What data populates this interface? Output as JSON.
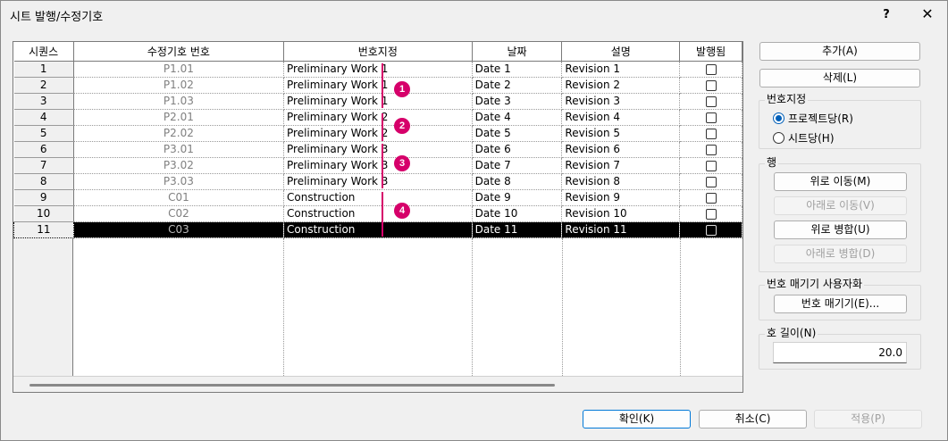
{
  "window": {
    "title": "시트 발행/수정기호",
    "help_label": "?",
    "close_label": "✕"
  },
  "grid": {
    "headers": [
      "시퀀스",
      "수정기호 번호",
      "번호지정",
      "날짜",
      "설명",
      "발행됨"
    ],
    "rows": [
      {
        "seq": "1",
        "number": "P1.01",
        "numbering": "Preliminary Work 1",
        "date": "Date 1",
        "description": "Revision 1",
        "issued": false
      },
      {
        "seq": "2",
        "number": "P1.02",
        "numbering": "Preliminary Work 1",
        "date": "Date 2",
        "description": "Revision 2",
        "issued": false
      },
      {
        "seq": "3",
        "number": "P1.03",
        "numbering": "Preliminary Work 1",
        "date": "Date 3",
        "description": "Revision 3",
        "issued": false
      },
      {
        "seq": "4",
        "number": "P2.01",
        "numbering": "Preliminary Work 2",
        "date": "Date 4",
        "description": "Revision 4",
        "issued": false
      },
      {
        "seq": "5",
        "number": "P2.02",
        "numbering": "Preliminary Work 2",
        "date": "Date 5",
        "description": "Revision 5",
        "issued": false
      },
      {
        "seq": "6",
        "number": "P3.01",
        "numbering": "Preliminary Work 3",
        "date": "Date 6",
        "description": "Revision 6",
        "issued": false
      },
      {
        "seq": "7",
        "number": "P3.02",
        "numbering": "Preliminary Work 3",
        "date": "Date 7",
        "description": "Revision 7",
        "issued": false
      },
      {
        "seq": "8",
        "number": "P3.03",
        "numbering": "Preliminary Work 3",
        "date": "Date 8",
        "description": "Revision 8",
        "issued": false
      },
      {
        "seq": "9",
        "number": "C01",
        "numbering": "Construction",
        "date": "Date 9",
        "description": "Revision 9",
        "issued": false
      },
      {
        "seq": "10",
        "number": "C02",
        "numbering": "Construction",
        "date": "Date 10",
        "description": "Revision 10",
        "issued": false
      },
      {
        "seq": "11",
        "number": "C03",
        "numbering": "Construction",
        "date": "Date 11",
        "description": "Revision 11",
        "issued": false
      }
    ],
    "selected_row": "11"
  },
  "callouts": [
    "1",
    "2",
    "3",
    "4"
  ],
  "callout_color": "#d6006a",
  "buttons": {
    "add": "추가(A)",
    "delete": "삭제(L)"
  },
  "numbering_group": {
    "label": "번호지정",
    "per_project": "프로젝트당(R)",
    "per_sheet": "시트당(H)",
    "selected": "per_project"
  },
  "row_group": {
    "label": "행",
    "move_up": "위로 이동(M)",
    "move_down": "아래로 이동(V)",
    "merge_up": "위로 병합(U)",
    "merge_down": "아래로 병합(D)"
  },
  "customize_group": {
    "label": "번호 매기기 사용자화",
    "numbering_button": "번호 매기기(E)..."
  },
  "arc_length": {
    "label": "호 길이(N)",
    "value": "20.0"
  },
  "footer": {
    "ok": "확인(K)",
    "cancel": "취소(C)",
    "apply": "적용(P)"
  }
}
